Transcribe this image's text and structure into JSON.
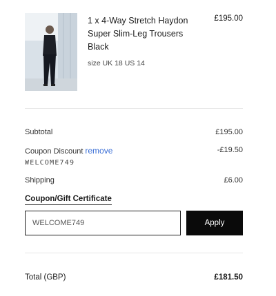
{
  "product": {
    "name": "1 x 4-Way Stretch Haydon Super Slim-Leg Trousers Black",
    "size": "size UK 18 US 14",
    "price": "£195.00"
  },
  "summary": {
    "subtotal_label": "Subtotal",
    "subtotal_value": "£195.00",
    "discount_label": "Coupon Discount",
    "remove_label": "remove",
    "discount_value": "-£19.50",
    "coupon_code": "WELCOME749",
    "shipping_label": "Shipping",
    "shipping_value": "£6.00"
  },
  "coupon": {
    "heading": "Coupon/Gift Certificate",
    "input_value": "WELCOME749",
    "apply_label": "Apply"
  },
  "total": {
    "label": "Total (GBP)",
    "value": "£181.50"
  },
  "colors": {
    "link": "#3b6fd6",
    "button_bg": "#0a0a0a",
    "divider": "#e6e6e6"
  }
}
